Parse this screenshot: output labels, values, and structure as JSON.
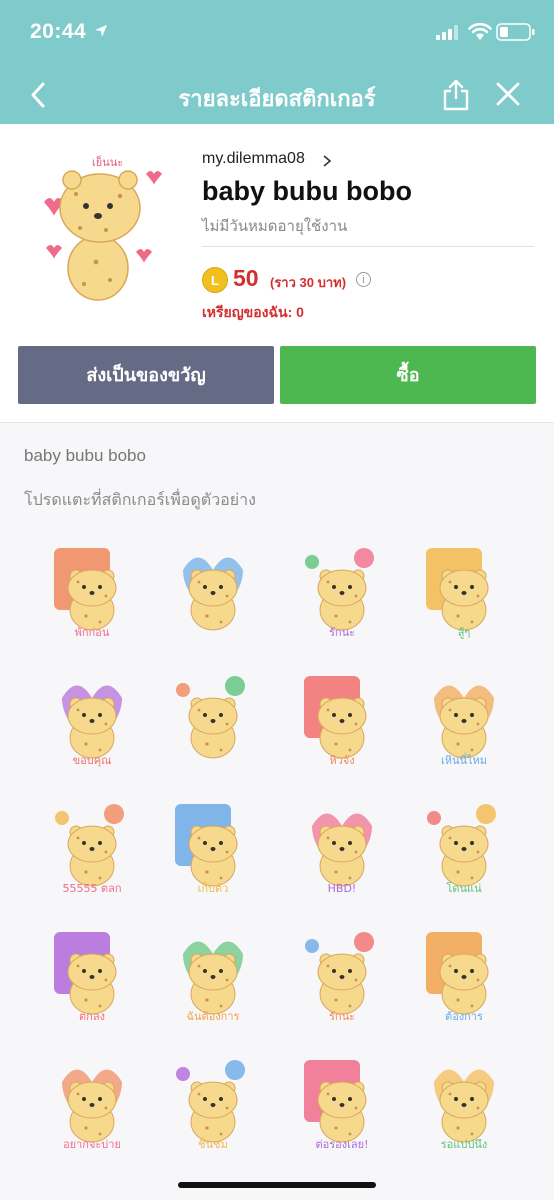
{
  "status": {
    "time": "20:44"
  },
  "nav": {
    "title": "รายละเอียดสติกเกอร์"
  },
  "pack": {
    "author": "my.dilemma08",
    "title": "baby bubu bobo",
    "validity": "ไม่มีวันหมดอายุใช้งาน",
    "coin_symbol": "L",
    "price": "50",
    "price_note": "(ราว  30 บาท)",
    "my_coins": "เหรียญของฉัน: 0",
    "sticker_label": "เย็นนะ"
  },
  "actions": {
    "gift_label": "ส่งเป็นของขวัญ",
    "buy_label": "ซื้อ"
  },
  "list": {
    "pack_name": "baby bubu bobo",
    "hint": "โปรดแตะที่สติกเกอร์เพื่อดูตัวอย่าง"
  },
  "stickers": [
    {
      "name": "sticker-1",
      "text": "พักก่อน"
    },
    {
      "name": "sticker-2",
      "text": ""
    },
    {
      "name": "sticker-3",
      "text": "รักนะ"
    },
    {
      "name": "sticker-4",
      "text": "สู้ๆ"
    },
    {
      "name": "sticker-5",
      "text": "ขอบคุณ"
    },
    {
      "name": "sticker-6",
      "text": ""
    },
    {
      "name": "sticker-7",
      "text": "หิวจัง"
    },
    {
      "name": "sticker-8",
      "text": "เหินนี่ไหม"
    },
    {
      "name": "sticker-9",
      "text": "55555 ตลก"
    },
    {
      "name": "sticker-10",
      "text": "เก็บตัว"
    },
    {
      "name": "sticker-11",
      "text": "HBD!"
    },
    {
      "name": "sticker-12",
      "text": "โดนแน่"
    },
    {
      "name": "sticker-13",
      "text": "ตกลง"
    },
    {
      "name": "sticker-14",
      "text": "ฉันต้องการ"
    },
    {
      "name": "sticker-15",
      "text": "รักนะ"
    },
    {
      "name": "sticker-16",
      "text": "ต้องการ"
    },
    {
      "name": "sticker-17",
      "text": "อยากจะบ่าย"
    },
    {
      "name": "sticker-18",
      "text": "ชื่นชม"
    },
    {
      "name": "sticker-19",
      "text": "ต่อรองเลย!"
    },
    {
      "name": "sticker-20",
      "text": "รอแปปนึง"
    }
  ],
  "colors": {
    "teal": "#7fcbcc",
    "gift": "#666b85",
    "buy": "#4cb84f",
    "price": "#d32f2f",
    "bear": "#f6d98c"
  }
}
